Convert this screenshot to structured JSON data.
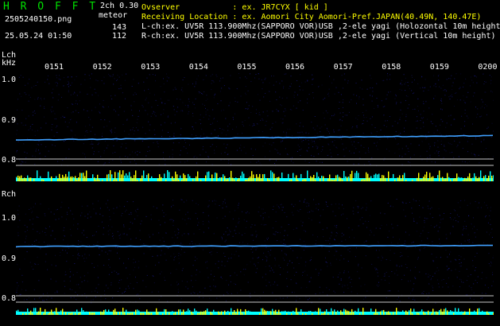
{
  "header": {
    "title": "H R O F F T",
    "mode": "2ch 0.30",
    "filename": "2505240150.png",
    "meteor_label": "meteor",
    "timestamp": "25.05.24 01:50",
    "count_l": "143",
    "count_r": "112",
    "info": [
      "Ovserver           : ex. JR7CYX [ kid ]",
      "Receiving Location : ex. Aomori City Aomori-Pref.JAPAN(40.49N, 140.47E)",
      "L-ch:ex. UV5R 113.900Mhz(SAPPORO VOR)USB ,2-ele yagi (Holozontal 10m height)",
      "R-ch:ex. UV5R 113.900Mhz(SAPPORO VOR)USB ,2-ele yagi (Vertical 10m height)"
    ]
  },
  "time_ticks": [
    "0151",
    "0152",
    "0153",
    "0154",
    "0155",
    "0156",
    "0157",
    "0158",
    "0159",
    "0200"
  ],
  "lch": {
    "label": "Lch",
    "unit": "kHz",
    "y_labels": [
      "1.0",
      "0.9",
      "0.8"
    ]
  },
  "rch": {
    "label": "Rch",
    "y_labels": [
      "1.0",
      "0.9",
      "0.8"
    ]
  },
  "colors": {
    "background": "#000000",
    "noise": "#1a1a8a",
    "carrier": "#3fa0ff",
    "yellow": "#ffff00",
    "cyan": "#00ffff",
    "grid_line": "#c8c8c8"
  }
}
